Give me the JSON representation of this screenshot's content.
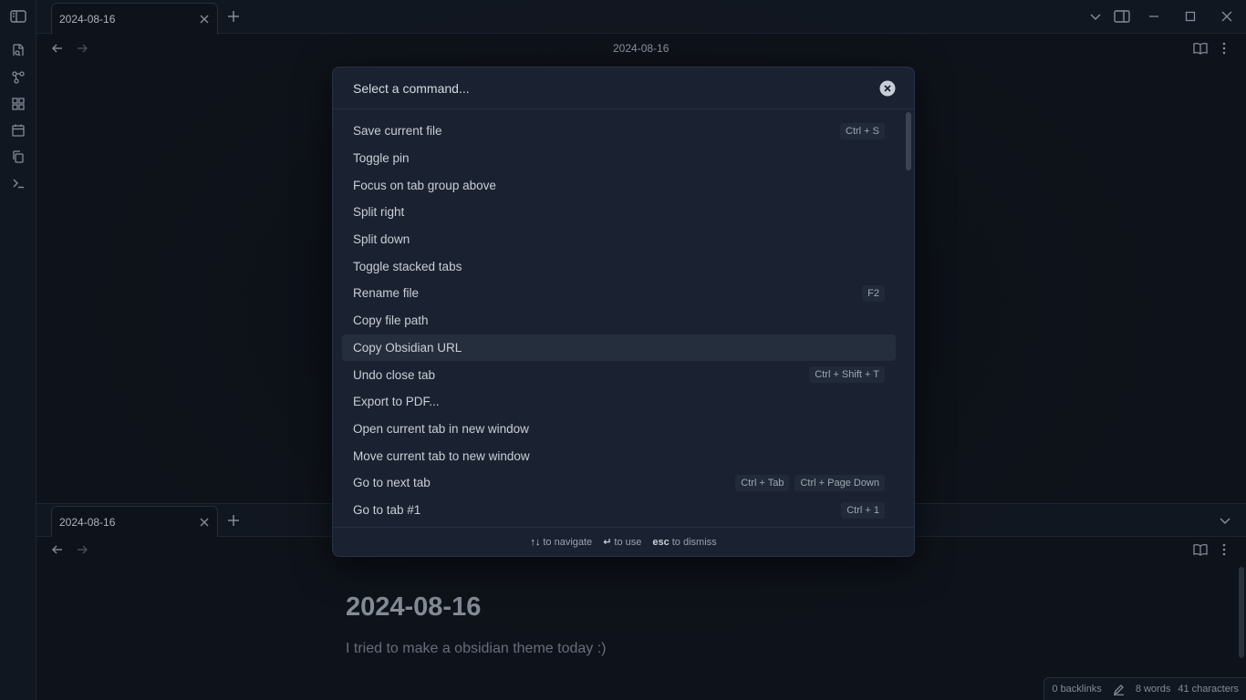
{
  "window": {
    "tab_title": "2024-08-16",
    "header_title": "2024-08-16"
  },
  "ribbon": {
    "items": [
      "sidebar-toggle-icon",
      "open-file-icon",
      "graph-icon",
      "canvas-icon",
      "calendar-icon",
      "copy-icon",
      "terminal-icon"
    ]
  },
  "bottom_pane": {
    "tab_title": "2024-08-16",
    "note_title": "2024-08-16",
    "note_body": "I tried to make a obsidian theme today :)"
  },
  "status_bar": {
    "backlinks": "0 backlinks",
    "words": "8 words",
    "characters": "41 characters"
  },
  "command_palette": {
    "placeholder": "Select a command...",
    "commands": [
      {
        "label": "Save current file",
        "hotkeys": [
          "Ctrl + S"
        ]
      },
      {
        "label": "Toggle pin",
        "hotkeys": []
      },
      {
        "label": "Focus on tab group above",
        "hotkeys": []
      },
      {
        "label": "Split right",
        "hotkeys": []
      },
      {
        "label": "Split down",
        "hotkeys": []
      },
      {
        "label": "Toggle stacked tabs",
        "hotkeys": []
      },
      {
        "label": "Rename file",
        "hotkeys": [
          "F2"
        ]
      },
      {
        "label": "Copy file path",
        "hotkeys": []
      },
      {
        "label": "Copy Obsidian URL",
        "hotkeys": [],
        "selected": true
      },
      {
        "label": "Undo close tab",
        "hotkeys": [
          "Ctrl + Shift + T"
        ]
      },
      {
        "label": "Export to PDF...",
        "hotkeys": []
      },
      {
        "label": "Open current tab in new window",
        "hotkeys": []
      },
      {
        "label": "Move current tab to new window",
        "hotkeys": []
      },
      {
        "label": "Go to next tab",
        "hotkeys": [
          "Ctrl + Tab",
          "Ctrl + Page Down"
        ]
      },
      {
        "label": "Go to tab #1",
        "hotkeys": [
          "Ctrl + 1"
        ]
      }
    ],
    "instructions": [
      {
        "key": "↑↓",
        "text": "to navigate"
      },
      {
        "key": "↵",
        "text": "to use"
      },
      {
        "key": "esc",
        "text": "to dismiss"
      }
    ]
  },
  "colors": {
    "background": "#0f141c",
    "modal": "#1a2231",
    "selected_row": "#252e3d"
  }
}
